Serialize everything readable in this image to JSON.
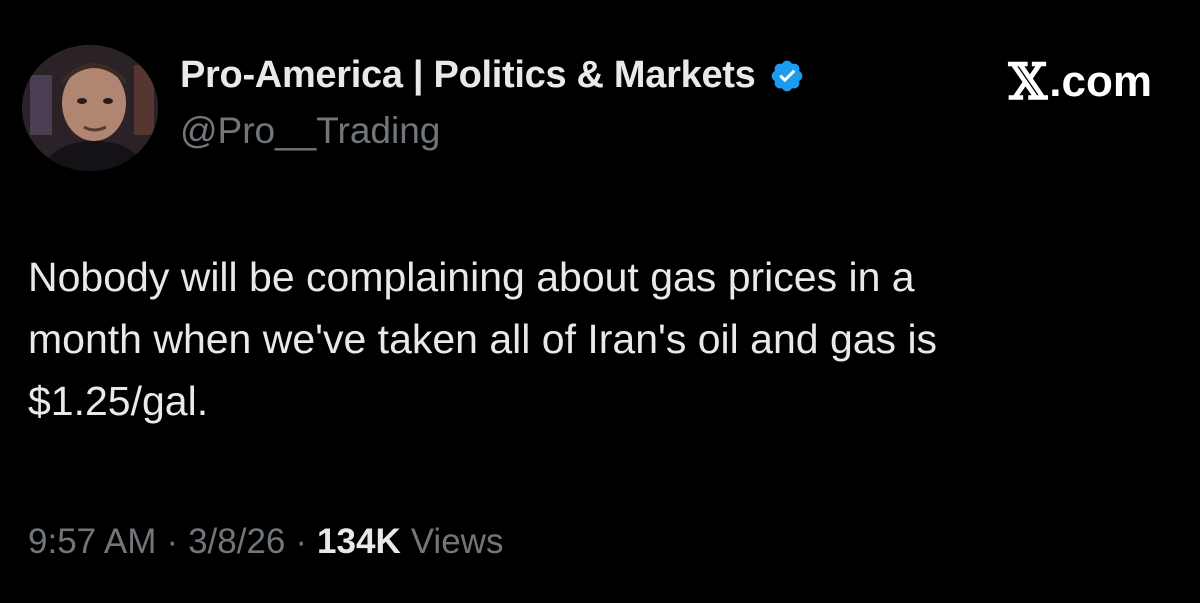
{
  "author": {
    "display_name": "Pro-America | Politics & Markets",
    "handle": "@Pro__Trading",
    "verified": true,
    "avatar_icon": "profile-photo",
    "verified_icon": "verified-badge-icon"
  },
  "brand": {
    "x_glyph": "𝕏",
    "suffix": ".com"
  },
  "tweet": {
    "text": "Nobody will be complaining about gas prices in a\nmonth when we've taken all of Iran's oil and gas is\n$1.25/gal."
  },
  "meta": {
    "time": "9:57 AM",
    "separator": "·",
    "date": "3/8/26",
    "views_count": "134K",
    "views_label": "Views"
  },
  "colors": {
    "background": "#000000",
    "primary_text": "#e7e9ea",
    "secondary_text": "#71767b",
    "verified_blue": "#1d9bf0"
  }
}
